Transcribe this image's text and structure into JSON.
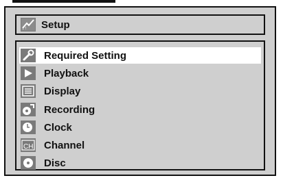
{
  "header": {
    "title": "Setup",
    "icon": "setup-icon"
  },
  "menu": {
    "selected_index": 0,
    "items": [
      {
        "label": "Required Setting",
        "icon": "wrench-icon"
      },
      {
        "label": "Playback",
        "icon": "play-icon"
      },
      {
        "label": "Display",
        "icon": "display-icon"
      },
      {
        "label": "Recording",
        "icon": "recording-icon"
      },
      {
        "label": "Clock",
        "icon": "clock-icon"
      },
      {
        "label": "Channel",
        "icon": "channel-icon"
      },
      {
        "label": "Disc",
        "icon": "disc-icon"
      }
    ]
  },
  "colors": {
    "panel": "#cfcfcf",
    "highlight": "#ffffff",
    "border": "#111111",
    "icon_gray": "#7a7a7a"
  }
}
